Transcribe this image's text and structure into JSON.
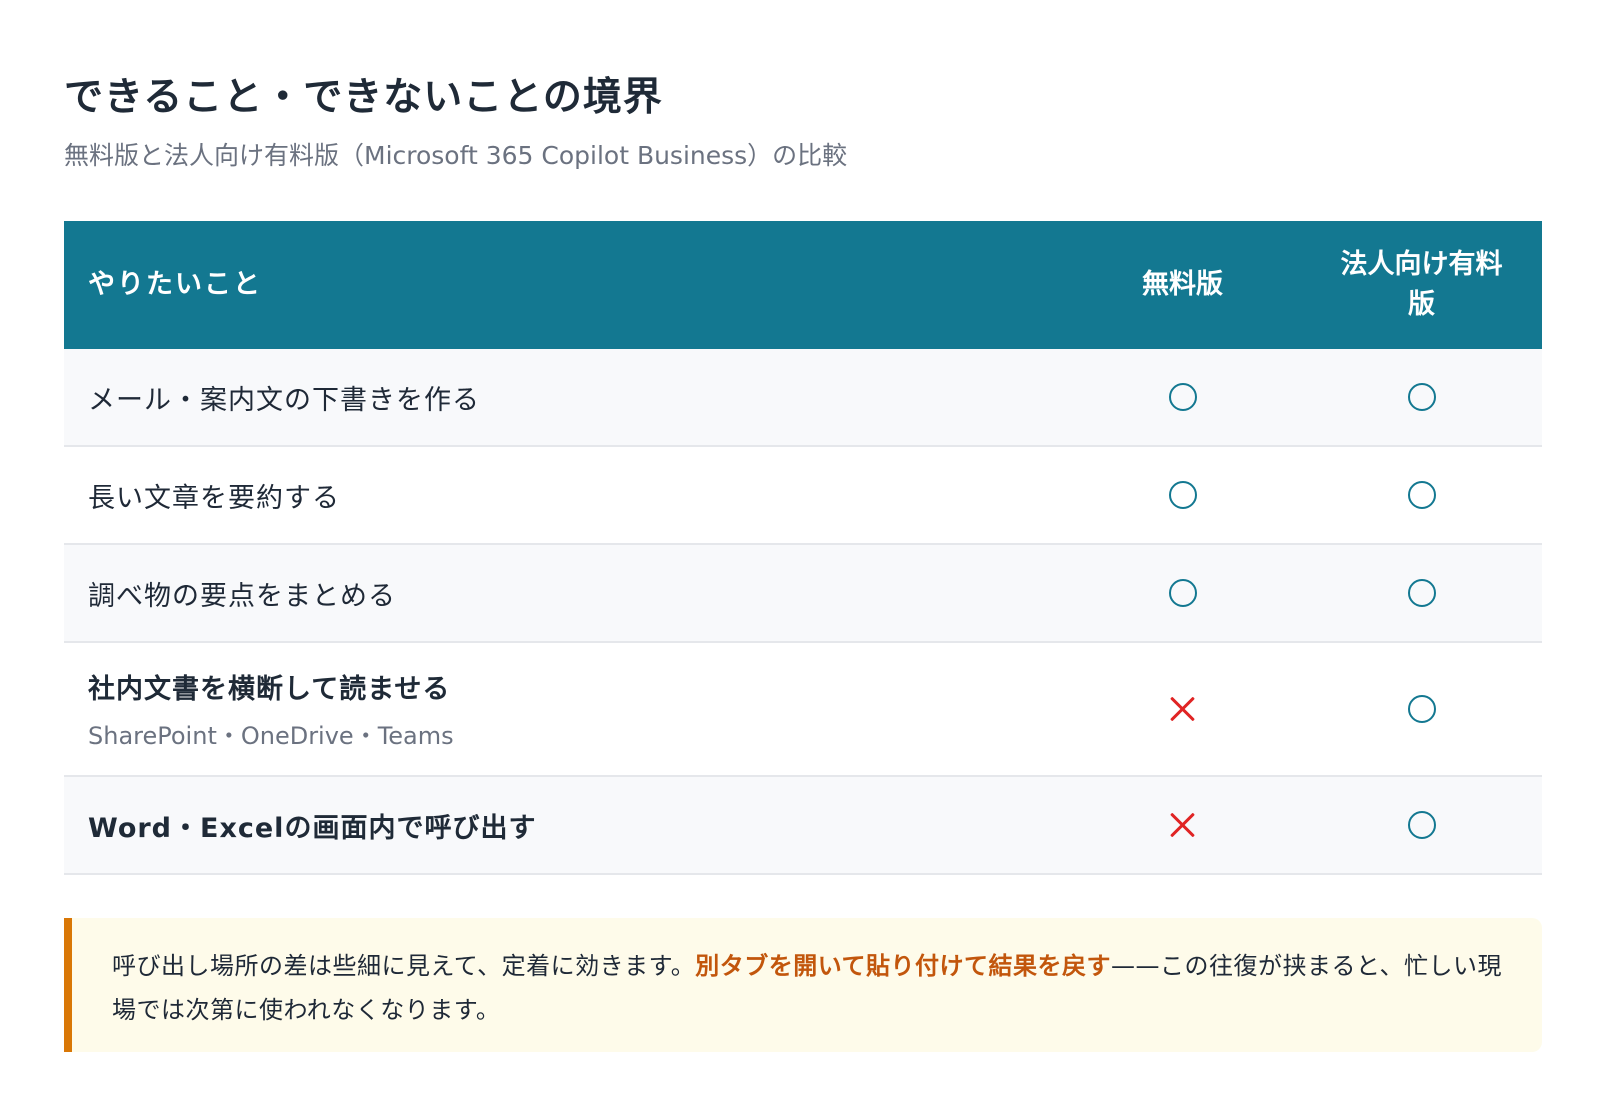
{
  "header": {
    "title": "できること・できないことの境界",
    "subtitle": "無料版と法人向け有料版（Microsoft 365 Copilot Business）の比較"
  },
  "table": {
    "columns": {
      "feature": "やりたいこと",
      "free": "無料版",
      "paid": "法人向け有料版"
    },
    "rows": [
      {
        "feature": "メール・案内文の下書きを作る",
        "sub": "",
        "free": "○",
        "paid": "○"
      },
      {
        "feature": "長い文章を要約する",
        "sub": "",
        "free": "○",
        "paid": "○"
      },
      {
        "feature": "調べ物の要点をまとめる",
        "sub": "",
        "free": "○",
        "paid": "○"
      },
      {
        "feature": "社内文書を横断して読ませる",
        "sub": "SharePoint・OneDrive・Teams",
        "free": "×",
        "paid": "○"
      },
      {
        "feature": "Word・Excelの画面内で呼び出す",
        "sub": "",
        "free": "×",
        "paid": "○"
      }
    ],
    "mark_colors": {
      "available": "#137891",
      "unavailable": "#e02424"
    }
  },
  "note": {
    "before": "呼び出し場所の差は些細に見えて、定着に効きます。",
    "highlight": "別タブを開いて貼り付けて結果を戻す",
    "after": "——この往復が挟まると、忙しい現場では次第に使われなくなります。",
    "accent_color": "#d97706"
  }
}
